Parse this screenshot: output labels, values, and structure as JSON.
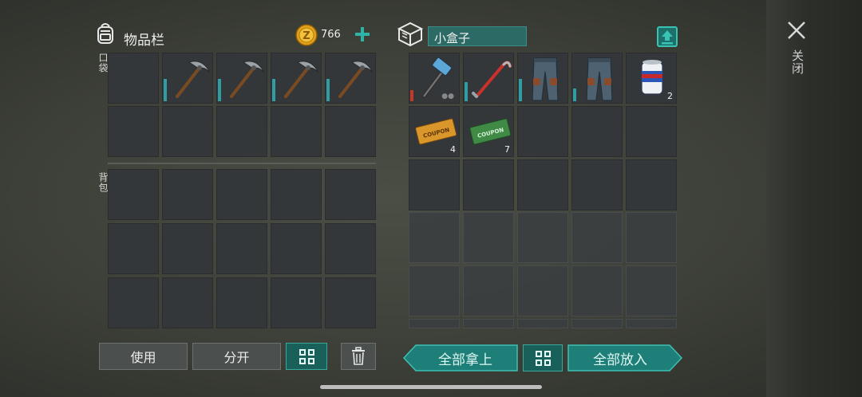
{
  "inventory": {
    "title": "物品栏",
    "coins": "766",
    "pocket_label": "口袋",
    "backpack_label": "背包"
  },
  "container": {
    "name": "小盒子"
  },
  "close_label": "关闭",
  "buttons": {
    "use": "使用",
    "split": "分开",
    "take_all": "全部拿上",
    "put_all": "全部放入"
  },
  "container_items": {
    "beer_qty": "2",
    "coupon_orange_qty": "4",
    "coupon_green_qty": "7",
    "coupon_text": "COUPON"
  },
  "colors": {
    "teal": "#1e7f78",
    "durability": "#2f9da3",
    "coin": "#e0a21c"
  }
}
